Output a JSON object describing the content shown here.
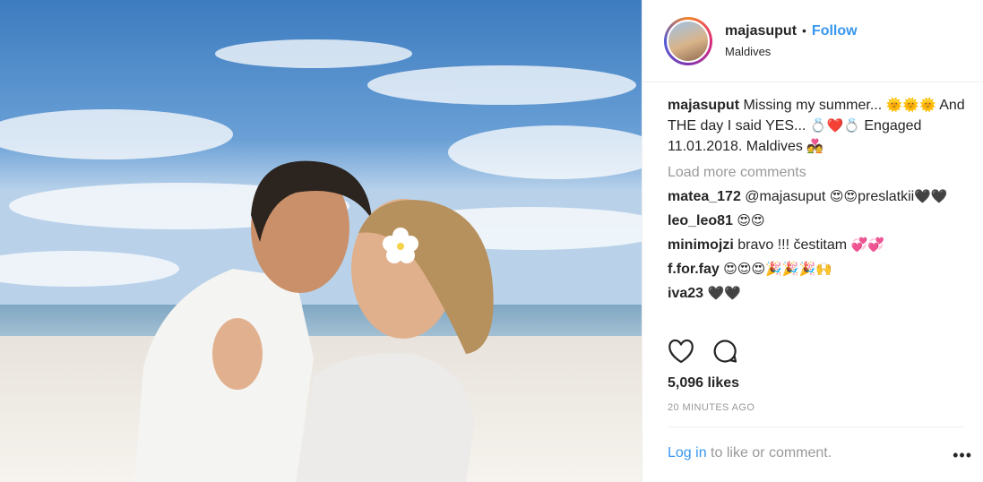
{
  "post": {
    "photo_icon": "couple-beach-photo",
    "header": {
      "username": "majasuput",
      "separator": "•",
      "follow_label": "Follow",
      "location": "Maldives"
    },
    "caption": {
      "username": "majasuput",
      "text_1": "Missing my summer...",
      "emoji_1": "🌞🌞🌞",
      "text_2": "And THE day I said YES...",
      "emoji_2": "💍❤️💍",
      "text_3": "Engaged 11.01.2018. Maldives",
      "emoji_3": "💑"
    },
    "load_more_label": "Load more comments",
    "comments": [
      {
        "user": "matea_172",
        "text": "@majasuput",
        "emoji": "😍😍",
        "text2": "preslatkii",
        "emoji2": "🖤🖤"
      },
      {
        "user": "leo_leo81",
        "text": "",
        "emoji": "😍😍",
        "text2": "",
        "emoji2": ""
      },
      {
        "user": "minimojzi",
        "text": "bravo !!! čestitam",
        "emoji": "💞💞",
        "text2": "",
        "emoji2": ""
      },
      {
        "user": "f.for.fay",
        "text": "",
        "emoji": "😍😍😍🎉🎉🎉🙌",
        "text2": "",
        "emoji2": ""
      },
      {
        "user": "iva23",
        "text": "",
        "emoji": "🖤🖤",
        "text2": "",
        "emoji2": ""
      }
    ],
    "actions": {
      "like_icon": "heart-icon",
      "comment_icon": "comment-icon"
    },
    "likes_label": "5,096 likes",
    "time_label": "20 MINUTES AGO",
    "login_link": "Log in",
    "login_rest": " to like or comment.",
    "more_label": "•••"
  },
  "colors": {
    "link": "#3897f0",
    "text": "#262626",
    "muted": "#999999",
    "sky": "#3f7fc0",
    "sand": "#f2efe9"
  }
}
